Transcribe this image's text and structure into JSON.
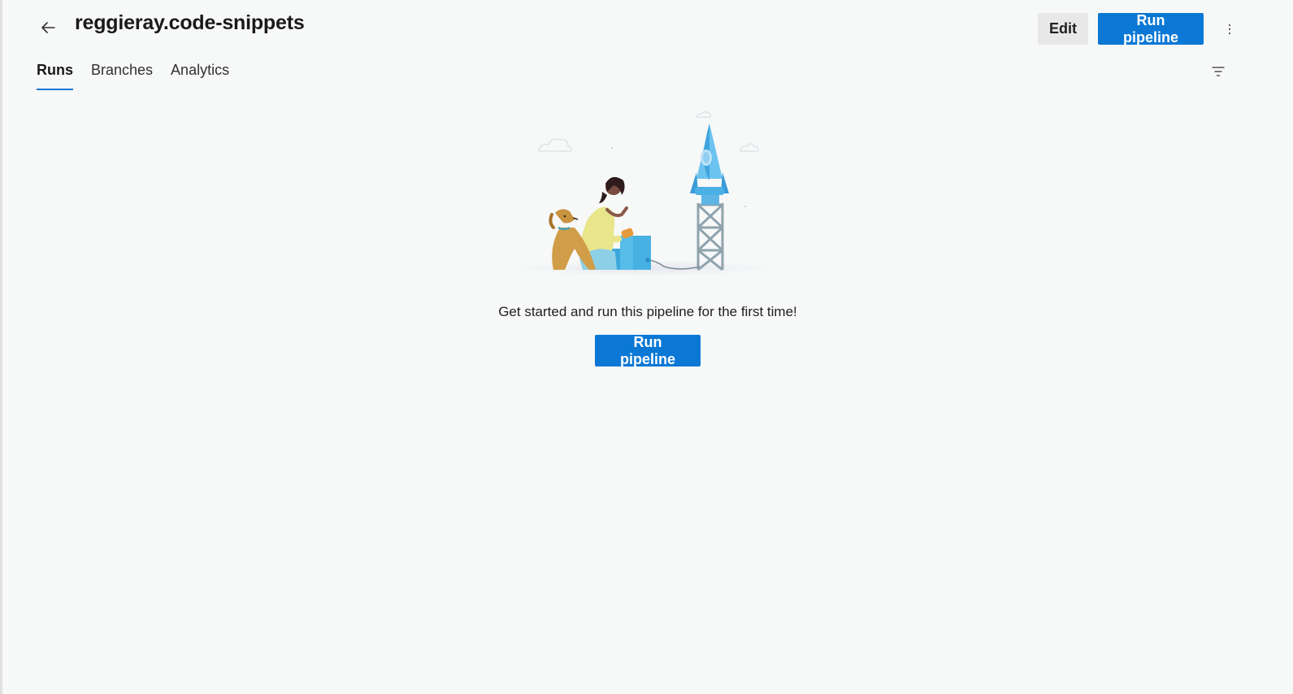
{
  "header": {
    "back_icon": "arrow-left-icon",
    "title": "reggieray.code-snippets",
    "edit_label": "Edit",
    "run_pipeline_label": "Run pipeline",
    "more_icon": "more-vertical-icon"
  },
  "tabs": [
    {
      "label": "Runs",
      "selected": true
    },
    {
      "label": "Branches",
      "selected": false
    },
    {
      "label": "Analytics",
      "selected": false
    }
  ],
  "toolbar": {
    "filter_icon": "filter-icon"
  },
  "empty_state": {
    "illustration": "person-dog-rocket-launch-illustration",
    "message": "Get started and run this pipeline for the first time!",
    "run_pipeline_label": "Run pipeline"
  },
  "colors": {
    "accent": "#0a78d4",
    "background": "#f7f8f8",
    "secondary_button": "#e8e8e8"
  }
}
